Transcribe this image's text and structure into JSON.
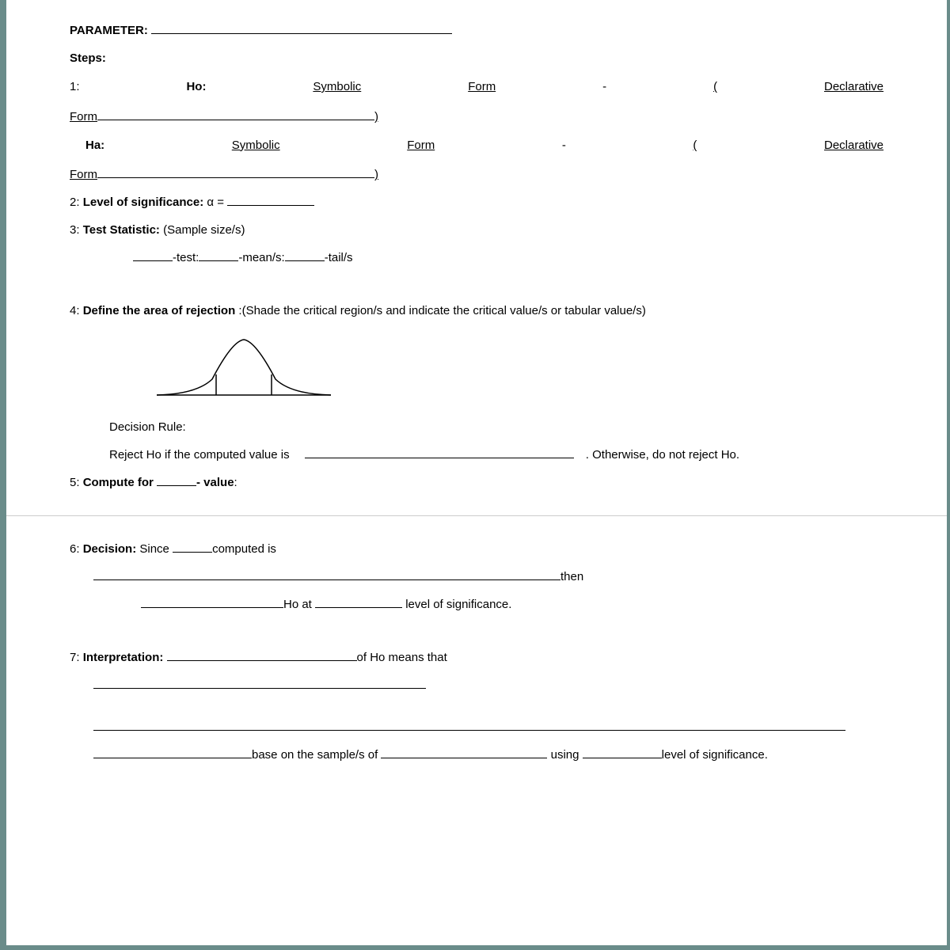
{
  "header": {
    "parameter": "PARAMETER:",
    "steps": "Steps:"
  },
  "s1": {
    "num": "1:",
    "ho": "Ho:",
    "ha": "Ha:",
    "symbolic": "Symbolic",
    "form": "Form",
    "dash": "-",
    "open": "(",
    "decl": "Declarative",
    "close": ")"
  },
  "s2": {
    "pre": "2: ",
    "label": "Level of significance:",
    "alpha": " α = "
  },
  "s3": {
    "pre": "3:  ",
    "label": "Test Statistic:",
    "post": " (Sample size/s)",
    "test": "-test:",
    "means": "-mean/s:",
    "tails": "-tail/s"
  },
  "s4": {
    "pre": "4: ",
    "label": "Define the area of rejection",
    "post": " :(Shade the critical region/s and indicate the critical value/s or tabular value/s)",
    "dr": "Decision Rule:",
    "reject": "Reject Ho if the computed value is ",
    "otherwise": ". Otherwise, do not reject Ho."
  },
  "s5": {
    "pre": "5: ",
    "compute": "Compute  for ",
    "value": "- value"
  },
  "s6": {
    "pre": "6: ",
    "decision": "Decision:",
    "since": " Since ",
    "computed": "computed is ",
    "then": "then",
    "hoat": "Ho at ",
    "level": " level of significance."
  },
  "s7": {
    "pre": "7: ",
    "interp": "Interpretation:",
    "ofho": "of Ho means that",
    "base": "base on the sample/s of ",
    "using": " using ",
    "level": "level of significance."
  }
}
